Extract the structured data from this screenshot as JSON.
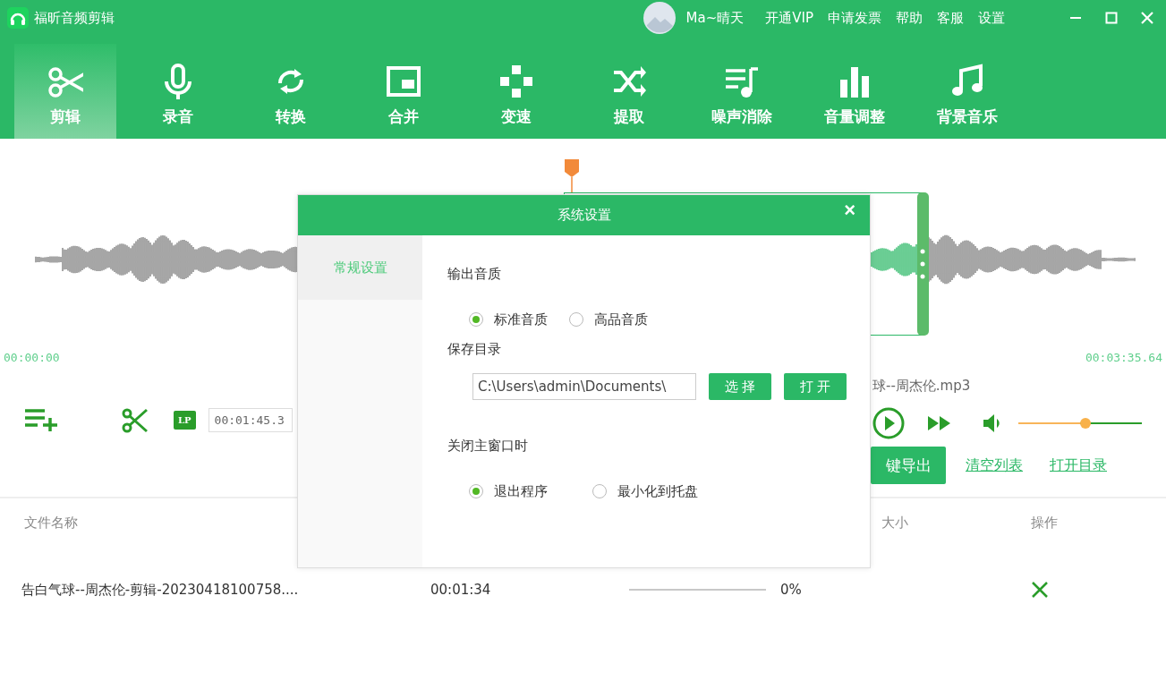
{
  "app": {
    "title": "福昕音频剪辑"
  },
  "user": {
    "name": "Ma~晴天"
  },
  "top_menu": [
    "开通VIP",
    "申请发票",
    "帮助",
    "客服",
    "设置"
  ],
  "toolbar": [
    {
      "label": "剪辑",
      "selected": true
    },
    {
      "label": "录音",
      "selected": false
    },
    {
      "label": "转换",
      "selected": false
    },
    {
      "label": "合并",
      "selected": false
    },
    {
      "label": "变速",
      "selected": false
    },
    {
      "label": "提取",
      "selected": false
    },
    {
      "label": "噪声消除",
      "selected": false
    },
    {
      "label": "音量调整",
      "selected": false
    },
    {
      "label": "背景音乐",
      "selected": false
    }
  ],
  "timeline": {
    "start": "00:00:00",
    "end": "00:03:35.64"
  },
  "player": {
    "file_name": "球--周杰伦.mp3",
    "lp_label": "LP",
    "cut_time": "00:01:45.3",
    "volume": {
      "level": 0.5
    }
  },
  "export": {
    "button": "键导出",
    "links": [
      "清空列表",
      "打开目录"
    ]
  },
  "table": {
    "columns": [
      "文件名称",
      "大小",
      "操作"
    ],
    "rows": [
      {
        "name": "告白气球--周杰伦-剪辑-20230418100758....",
        "duration": "00:01:34",
        "progress": {
          "level": 0,
          "reading": "0%"
        }
      }
    ]
  },
  "dialog": {
    "title": "系统设置",
    "close": "×",
    "nav": [
      {
        "label": "常规设置",
        "selected": true
      }
    ],
    "sections": [
      {
        "kind": "radio",
        "label": "输出音质",
        "options": [
          {
            "label": "标准音质",
            "selected": true
          },
          {
            "label": "高品音质",
            "selected": false
          }
        ]
      },
      {
        "kind": "path",
        "label": "保存目录",
        "value": "C:\\Users\\admin\\Documents\\",
        "buttons": [
          "选 择",
          "打 开"
        ]
      },
      {
        "kind": "radio",
        "label": "关闭主窗口时",
        "options": [
          {
            "label": "退出程序",
            "selected": true
          },
          {
            "label": "最小化到托盘",
            "selected": false
          }
        ]
      }
    ]
  }
}
